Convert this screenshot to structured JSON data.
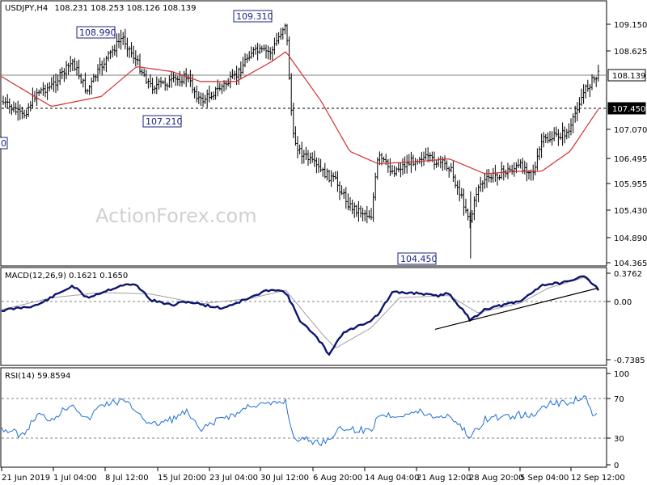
{
  "header": {
    "symbol": "USDJPY,H4",
    "ohlc": "108.231 108.253 108.126 108.139"
  },
  "watermark": "ActionForex.com",
  "colors": {
    "bars": "#000000",
    "ma": "#d32f2f",
    "macd": "#0d1470",
    "signal": "#a0a0a0",
    "rsi": "#1e6fd9",
    "tag_bg": "#ffffff",
    "tag_border": "#1a237e"
  },
  "chart_data": [
    {
      "type": "ohlc",
      "pane": "price",
      "title": "USDJPY,H4 108.231 108.253 108.126 108.139",
      "ylim": [
        104.365,
        109.58
      ],
      "y_ticks": [
        "109.150",
        "108.625",
        "108.139",
        "107.450",
        "107.070",
        "106.495",
        "105.955",
        "105.430",
        "104.890",
        "104.365"
      ],
      "current_price": "108.139",
      "support_line": "107.450",
      "overlays": [
        "moving average (red)"
      ],
      "annotations": [
        {
          "label": "108.990",
          "x": "8 Jul 2019",
          "y": 108.99
        },
        {
          "label": "109.310",
          "x": "30 Jul 2019",
          "y": 109.31
        },
        {
          "label": "107.210",
          "x": "15 Jul 2019",
          "y": 107.21
        },
        {
          "label": "104.450",
          "x": "26 Aug 2019",
          "y": 104.45
        }
      ],
      "close_path": [
        [
          "21 Jun 2019",
          107.6
        ],
        [
          "24 Jun 2019",
          107.3
        ],
        [
          "26 Jun 2019",
          107.8
        ],
        [
          "28 Jun 2019",
          107.9
        ],
        [
          "1 Jul 2019",
          108.4
        ],
        [
          "3 Jul 2019",
          107.8
        ],
        [
          "5 Jul 2019",
          108.3
        ],
        [
          "8 Jul 2019",
          108.9
        ],
        [
          "10 Jul 2019",
          108.4
        ],
        [
          "12 Jul 2019",
          107.9
        ],
        [
          "15 Jul 2019",
          108.0
        ],
        [
          "17 Jul 2019",
          108.1
        ],
        [
          "19 Jul 2019",
          107.6
        ],
        [
          "22 Jul 2019",
          107.9
        ],
        [
          "24 Jul 2019",
          108.1
        ],
        [
          "26 Jul 2019",
          108.6
        ],
        [
          "29 Jul 2019",
          108.6
        ],
        [
          "31 Jul 2019",
          109.2
        ],
        [
          "1 Aug 2019",
          106.9
        ],
        [
          "2 Aug 2019",
          106.6
        ],
        [
          "5 Aug 2019",
          106.2
        ],
        [
          "7 Aug 2019",
          106.0
        ],
        [
          "9 Aug 2019",
          105.5
        ],
        [
          "12 Aug 2019",
          105.3
        ],
        [
          "13 Aug 2019",
          106.5
        ],
        [
          "15 Aug 2019",
          106.2
        ],
        [
          "19 Aug 2019",
          106.5
        ],
        [
          "21 Aug 2019",
          106.4
        ],
        [
          "23 Aug 2019",
          106.3
        ],
        [
          "26 Aug 2019",
          105.2
        ],
        [
          "27 Aug 2019",
          105.9
        ],
        [
          "29 Aug 2019",
          106.1
        ],
        [
          "2 Sep 2019",
          106.3
        ],
        [
          "4 Sep 2019",
          106.2
        ],
        [
          "5 Sep 2019",
          106.8
        ],
        [
          "9 Sep 2019",
          107.0
        ],
        [
          "10 Sep 2019",
          107.5
        ],
        [
          "11 Sep 2019",
          107.8
        ],
        [
          "12 Sep 2019",
          108.0
        ],
        [
          "13 Sep 2019",
          108.139
        ]
      ],
      "ma_path": [
        [
          "21 Jun 2019",
          108.1
        ],
        [
          "28 Jun 2019",
          107.5
        ],
        [
          "5 Jul 2019",
          107.7
        ],
        [
          "10 Jul 2019",
          108.3
        ],
        [
          "15 Jul 2019",
          108.2
        ],
        [
          "19 Jul 2019",
          108.0
        ],
        [
          "24 Jul 2019",
          108.0
        ],
        [
          "29 Jul 2019",
          108.4
        ],
        [
          "31 Jul 2019",
          108.6
        ],
        [
          "5 Aug 2019",
          107.6
        ],
        [
          "9 Aug 2019",
          106.6
        ],
        [
          "13 Aug 2019",
          106.35
        ],
        [
          "19 Aug 2019",
          106.4
        ],
        [
          "23 Aug 2019",
          106.45
        ],
        [
          "28 Aug 2019",
          106.15
        ],
        [
          "2 Sep 2019",
          106.2
        ],
        [
          "5 Sep 2019",
          106.2
        ],
        [
          "9 Sep 2019",
          106.6
        ],
        [
          "13 Sep 2019",
          107.45
        ]
      ]
    },
    {
      "type": "line",
      "pane": "macd",
      "title": "MACD(12,26,9) 0.1621 0.1650",
      "ylim": [
        -0.7385,
        0.3762
      ],
      "y_ticks": [
        "0.3762",
        "0.00",
        "-0.7385"
      ],
      "series": [
        {
          "name": "MACD",
          "points": [
            [
              "21 Jun 2019",
              -0.12
            ],
            [
              "26 Jun 2019",
              -0.05
            ],
            [
              "1 Jul 2019",
              0.21
            ],
            [
              "3 Jul 2019",
              0.05
            ],
            [
              "8 Jul 2019",
              0.22
            ],
            [
              "10 Jul 2019",
              0.22
            ],
            [
              "12 Jul 2019",
              0.02
            ],
            [
              "15 Jul 2019",
              -0.05
            ],
            [
              "17 Jul 2019",
              0.0
            ],
            [
              "22 Jul 2019",
              -0.09
            ],
            [
              "24 Jul 2019",
              -0.02
            ],
            [
              "26 Jul 2019",
              0.05
            ],
            [
              "29 Jul 2019",
              0.17
            ],
            [
              "31 Jul 2019",
              0.12
            ],
            [
              "2 Aug 2019",
              -0.25
            ],
            [
              "5 Aug 2019",
              -0.55
            ],
            [
              "6 Aug 2019",
              -0.71
            ],
            [
              "8 Aug 2019",
              -0.42
            ],
            [
              "12 Aug 2019",
              -0.25
            ],
            [
              "13 Aug 2019",
              -0.17
            ],
            [
              "15 Aug 2019",
              0.12
            ],
            [
              "19 Aug 2019",
              0.11
            ],
            [
              "21 Aug 2019",
              0.07
            ],
            [
              "23 Aug 2019",
              0.11
            ],
            [
              "26 Aug 2019",
              -0.25
            ],
            [
              "28 Aug 2019",
              -0.1
            ],
            [
              "2 Sep 2019",
              0.0
            ],
            [
              "5 Sep 2019",
              0.22
            ],
            [
              "9 Sep 2019",
              0.26
            ],
            [
              "11 Sep 2019",
              0.35
            ],
            [
              "13 Sep 2019",
              0.1621
            ]
          ]
        },
        {
          "name": "Signal",
          "points": [
            [
              "21 Jun 2019",
              -0.11
            ],
            [
              "28 Jun 2019",
              0.05
            ],
            [
              "5 Jul 2019",
              0.12
            ],
            [
              "12 Jul 2019",
              0.1
            ],
            [
              "19 Jul 2019",
              -0.03
            ],
            [
              "26 Jul 2019",
              0.04
            ],
            [
              "31 Jul 2019",
              0.15
            ],
            [
              "5 Aug 2019",
              -0.42
            ],
            [
              "7 Aug 2019",
              -0.62
            ],
            [
              "12 Aug 2019",
              -0.35
            ],
            [
              "16 Aug 2019",
              0.05
            ],
            [
              "23 Aug 2019",
              0.08
            ],
            [
              "27 Aug 2019",
              -0.15
            ],
            [
              "2 Sep 2019",
              -0.02
            ],
            [
              "6 Sep 2019",
              0.18
            ],
            [
              "11 Sep 2019",
              0.32
            ],
            [
              "13 Sep 2019",
              0.165
            ]
          ]
        }
      ],
      "trendline": [
        [
          "21 Aug 2019",
          -0.37
        ],
        [
          "13 Sep 2019",
          0.18
        ]
      ]
    },
    {
      "type": "line",
      "pane": "rsi",
      "title": "RSI(14) 59.8594",
      "ylim": [
        0,
        100
      ],
      "y_ticks": [
        "100",
        "70",
        "30",
        "0"
      ],
      "levels": [
        70,
        30
      ],
      "series": [
        {
          "name": "RSI(14)",
          "points": [
            [
              "21 Jun 2019",
              40
            ],
            [
              "24 Jun 2019",
              32
            ],
            [
              "26 Jun 2019",
              55
            ],
            [
              "28 Jun 2019",
              50
            ],
            [
              "1 Jul 2019",
              68
            ],
            [
              "3 Jul 2019",
              48
            ],
            [
              "5 Jul 2019",
              66
            ],
            [
              "8 Jul 2019",
              70
            ],
            [
              "10 Jul 2019",
              60
            ],
            [
              "12 Jul 2019",
              43
            ],
            [
              "15 Jul 2019",
              50
            ],
            [
              "17 Jul 2019",
              58
            ],
            [
              "19 Jul 2019",
              37
            ],
            [
              "22 Jul 2019",
              52
            ],
            [
              "24 Jul 2019",
              55
            ],
            [
              "26 Jul 2019",
              66
            ],
            [
              "29 Jul 2019",
              66
            ],
            [
              "31 Jul 2019",
              70
            ],
            [
              "1 Aug 2019",
              30
            ],
            [
              "5 Aug 2019",
              24
            ],
            [
              "8 Aug 2019",
              40
            ],
            [
              "12 Aug 2019",
              37
            ],
            [
              "13 Aug 2019",
              55
            ],
            [
              "15 Aug 2019",
              54
            ],
            [
              "19 Aug 2019",
              58
            ],
            [
              "21 Aug 2019",
              52
            ],
            [
              "23 Aug 2019",
              55
            ],
            [
              "26 Aug 2019",
              30
            ],
            [
              "28 Aug 2019",
              50
            ],
            [
              "2 Sep 2019",
              55
            ],
            [
              "4 Sep 2019",
              52
            ],
            [
              "5 Sep 2019",
              65
            ],
            [
              "9 Sep 2019",
              69
            ],
            [
              "11 Sep 2019",
              76
            ],
            [
              "12 Sep 2019",
              56
            ],
            [
              "13 Sep 2019",
              59.8594
            ]
          ]
        }
      ]
    }
  ],
  "x_axis": {
    "labels": [
      "21 Jun 2019",
      "1 Jul 04:00",
      "8 Jul 12:00",
      "15 Jul 20:00",
      "23 Jul 04:00",
      "30 Jul 12:00",
      "6 Aug 20:00",
      "14 Aug 04:00",
      "21 Aug 12:00",
      "28 Aug 20:00",
      "5 Sep 04:00",
      "12 Sep 12:00"
    ]
  }
}
